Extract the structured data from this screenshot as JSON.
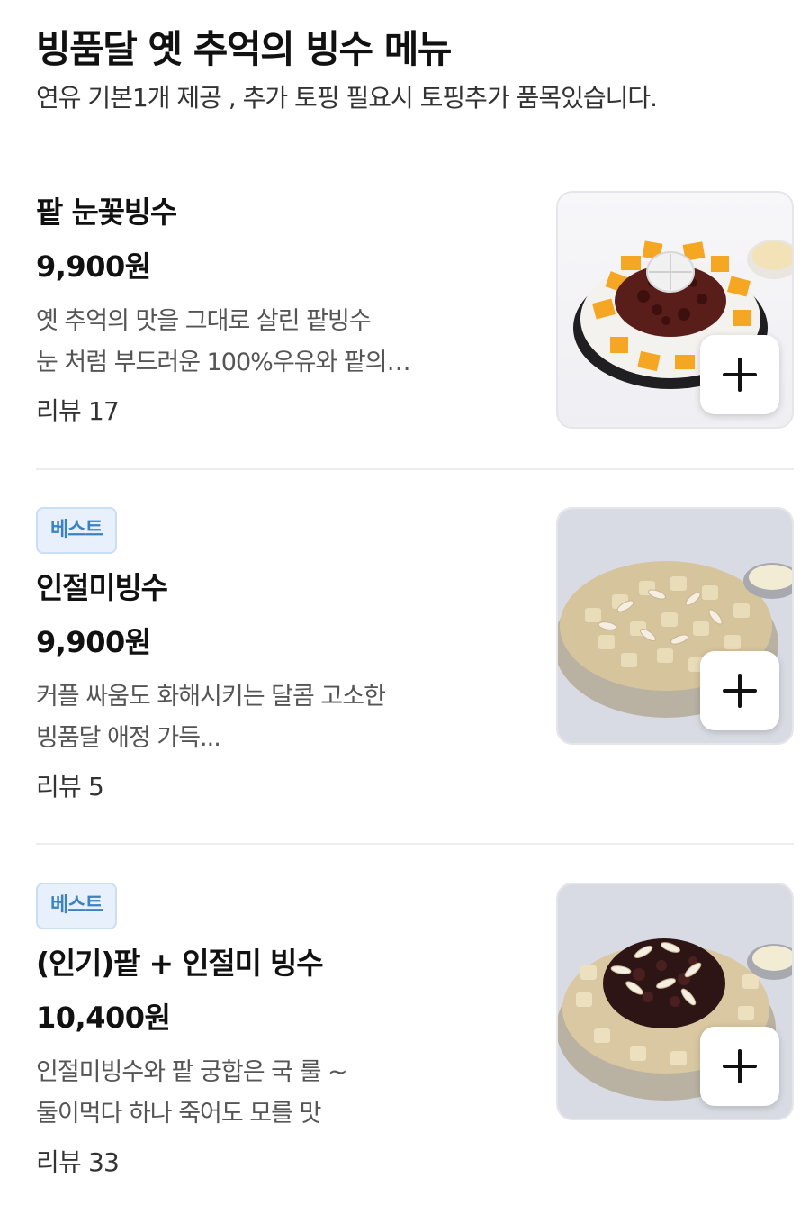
{
  "header": {
    "title": "빙품달 옛 추억의 빙수 메뉴",
    "subtitle": "연유 기본1개 제공 , 추가 토핑 필요시 토핑추가 품목있습니다."
  },
  "items": [
    {
      "name": "팥 눈꽃빙수",
      "price": "9,900원",
      "desc_line1": "옛 추억의 맛을 그대로 살린 팥빙수",
      "desc_line2": "눈 처럼 부드러운 100%우유와 팥의…",
      "review": "리뷰 17",
      "image_icon": "bingsu-red-bean-mango-image"
    },
    {
      "badge": "베스트",
      "name": "인절미빙수",
      "price": "9,900원",
      "desc_line1": "커플 싸움도 화해시키는 달콤 고소한",
      "desc_line2": "빙품달 애정 가득...",
      "review": "리뷰 5",
      "image_icon": "bingsu-injeolmi-image"
    },
    {
      "badge": "베스트",
      "name": "(인기)팥 + 인절미 빙수",
      "price": "10,400원",
      "desc_line1": "인절미빙수와 팥 궁합은 국 룰 ~",
      "desc_line2": "둘이먹다 하나 죽어도 모를 맛",
      "review": "리뷰 33",
      "image_icon": "bingsu-red-bean-injeolmi-image"
    }
  ],
  "add_icon": "plus-icon",
  "colors": {
    "badge_bg": "#e8f1fb",
    "badge_text": "#3b82c4",
    "divider": "#ececee"
  }
}
